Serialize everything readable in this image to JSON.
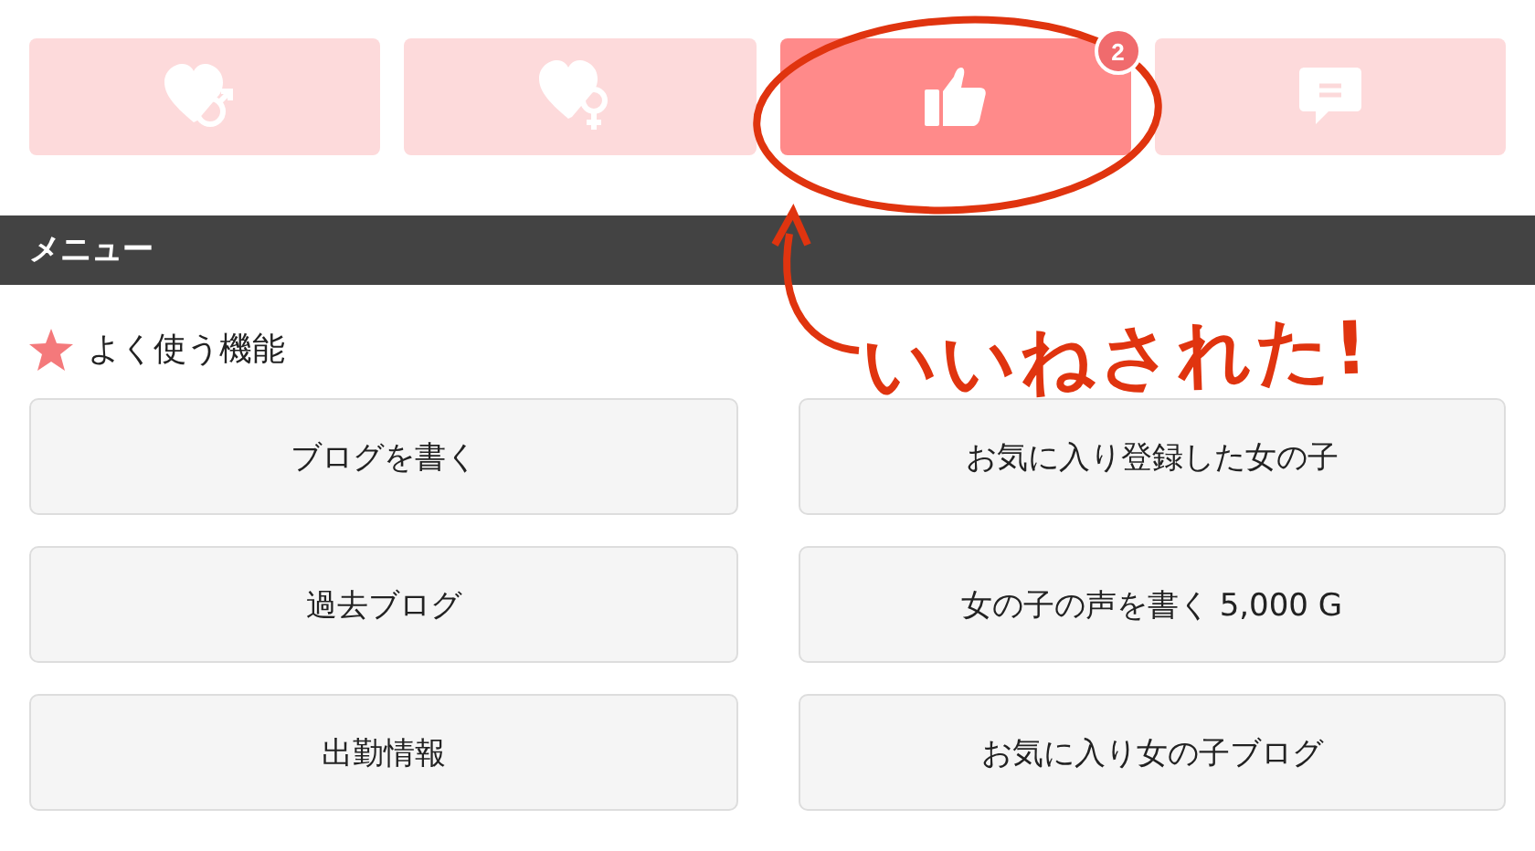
{
  "tabs": [
    {
      "kind": "heart-male",
      "selected": false
    },
    {
      "kind": "heart-female",
      "selected": false
    },
    {
      "kind": "like",
      "selected": true,
      "badge": "2"
    },
    {
      "kind": "message",
      "selected": false
    }
  ],
  "menu_bar": {
    "title": "メニュー"
  },
  "section": {
    "title": "よく使う機能"
  },
  "menu_buttons": [
    {
      "label": "ブログを書く"
    },
    {
      "label": "お気に入り登録した女の子"
    },
    {
      "label": "過去ブログ"
    },
    {
      "label": "女の子の声を書く 5,000 G"
    },
    {
      "label": "出勤情報"
    },
    {
      "label": "お気に入り女の子ブログ"
    }
  ],
  "annotation": {
    "text": "いいねされた!"
  }
}
